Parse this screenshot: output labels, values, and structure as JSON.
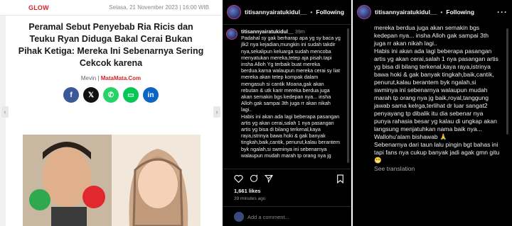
{
  "article": {
    "site": "GLOW",
    "date": "Selasa, 21 November 2023 | 16:00 WIB",
    "headline": "Peramal Sebut Penyebab Ria Ricis dan Teuku Ryan Diduga Bakal Cerai Bukan Pihak Ketiga: Mereka Ini Sebenarnya Sering Cekcok karena",
    "author": "Mevin",
    "source": "MataMata.Com",
    "share": [
      {
        "icon": "facebook-icon",
        "glyph": "f",
        "color": "#3b5998"
      },
      {
        "icon": "x-icon",
        "glyph": "𝕏",
        "color": "#111111"
      },
      {
        "icon": "whatsapp-icon",
        "glyph": "✆",
        "color": "#25d366"
      },
      {
        "icon": "line-icon",
        "glyph": "▭",
        "color": "#06c755"
      },
      {
        "icon": "linkedin-icon",
        "glyph": "in",
        "color": "#0a66c2"
      }
    ]
  },
  "post_left": {
    "username": "titisannyairatukidul__",
    "following": "Following",
    "time": "39m",
    "caption": "Padahal sy gak berharap apa yg sy baca yg jlk2 nya kejadian,mungkin ini sudah takdir nya,sekalipun keluarga sudah mencoba menyatukan mereka,tetep aja pisah.tapi insha Alloh Yg terbaik buat mereka berdua.karna walaupun mereka cerai sy liat mereka akan tetep kompak dalam mengasuh si cantik Moana,gak akan rebutan & utk karir mereka berdua juga akan semakin bgs kedepan nya... insha Alloh gak sampai 3th juga rr akan nikah lagi..\nHabis ini akan ada lagi beberapa pasangan artis yg akan cerai,salah 1 nya pasangan artis yg bisa di bilang terkenal,kaya raya,istrinya bawa hoki & gak banyak tingkah,baik,cantik, penurut,kalau berantem byk ngalah,si swminya ini sebenarnya walaupun mudah marah tp orang nya jg",
    "likes": "1,661 likes",
    "ago": "39 minutes ago",
    "comment_placeholder": "Add a comment..."
  },
  "post_right": {
    "username": "titisannyairatukidul__",
    "following": "Following",
    "caption": "mereka berdua juga akan semakin bgs kedepan nya... insha Alloh gak sampai 3th juga rr akan nikah lagi..\nHabis ini akan ada lagi beberapa pasangan artis yg akan cerai,salah 1 nya pasangan artis yg bisa di bilang terkenal,kaya raya,istrinya bawa hoki & gak banyak tingkah,baik,cantik, penurut,kalau berantem byk ngalah,si swminya ini sebenarnya walaupun mudah marah tp orang nya jg baik,royal,tanggung jawab sama kelrga,terlihat dr luar sangat2 penyayang tp dibalik itu dia sebenar nya punya rahasia besar yg kalau di ungkap akan langsung menjatuhkan nama baik nya...\nWallohu'alam bishawab 🙏\nSebenarnya dari taun lalu pingin bgt bahas ini tapi fans nya cukup banyak jadi agak gmn gitu 😁",
    "see_translation": "See translation"
  }
}
